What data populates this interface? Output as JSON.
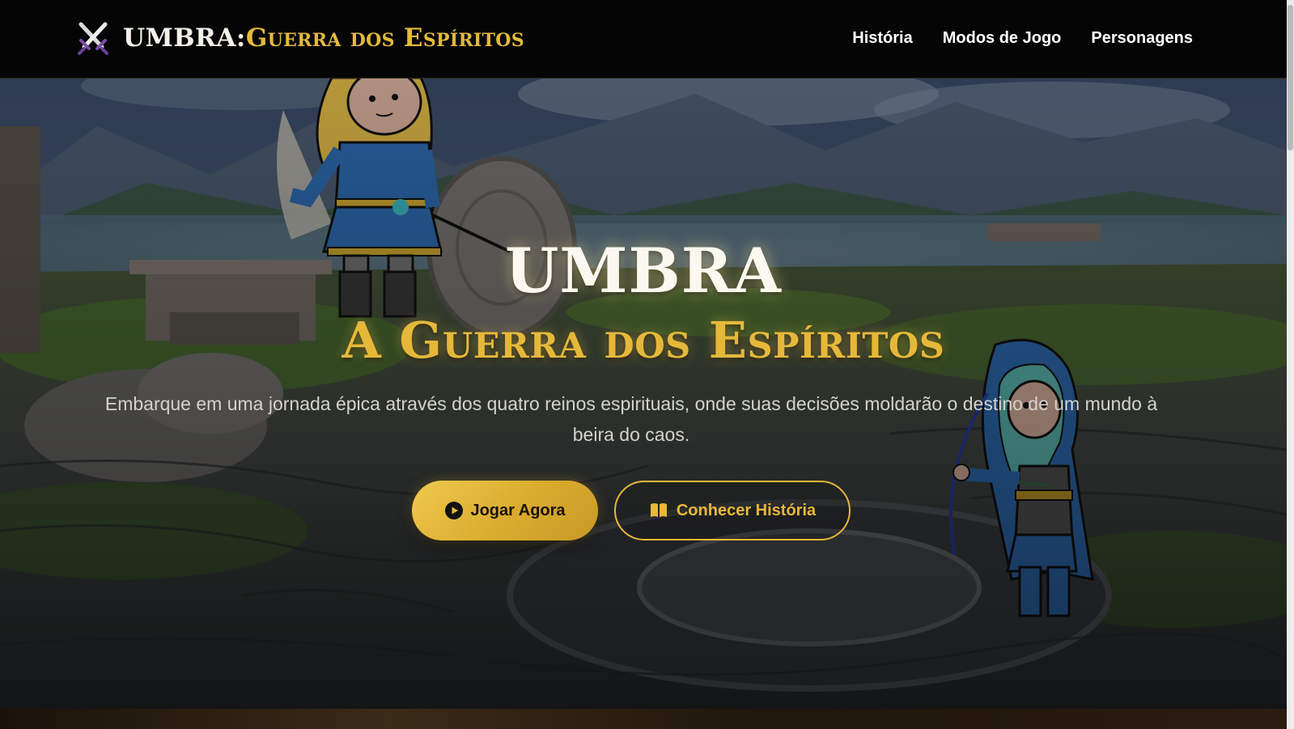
{
  "navbar": {
    "brand_main": "UMBRA:",
    "brand_sub": "Guerra dos Espíritos",
    "brand_icon": "crossed-swords-icon",
    "links": [
      {
        "label": "História"
      },
      {
        "label": "Modos de Jogo"
      },
      {
        "label": "Personagens"
      }
    ]
  },
  "hero": {
    "title": "UMBRA",
    "subtitle": "A Guerra dos Espíritos",
    "description": "Embarque em uma jornada épica através dos quatro reinos espirituais, onde suas decisões moldarão o destino de um mundo à beira do caos.",
    "primary_button": {
      "label": "Jogar Agora",
      "icon": "play-circle-icon"
    },
    "secondary_button": {
      "label": "Conhecer História",
      "icon": "open-book-icon"
    }
  },
  "colors": {
    "accent_gold": "#e6b83a",
    "nav_background": "#050505",
    "title_white": "#fbf8ef"
  }
}
